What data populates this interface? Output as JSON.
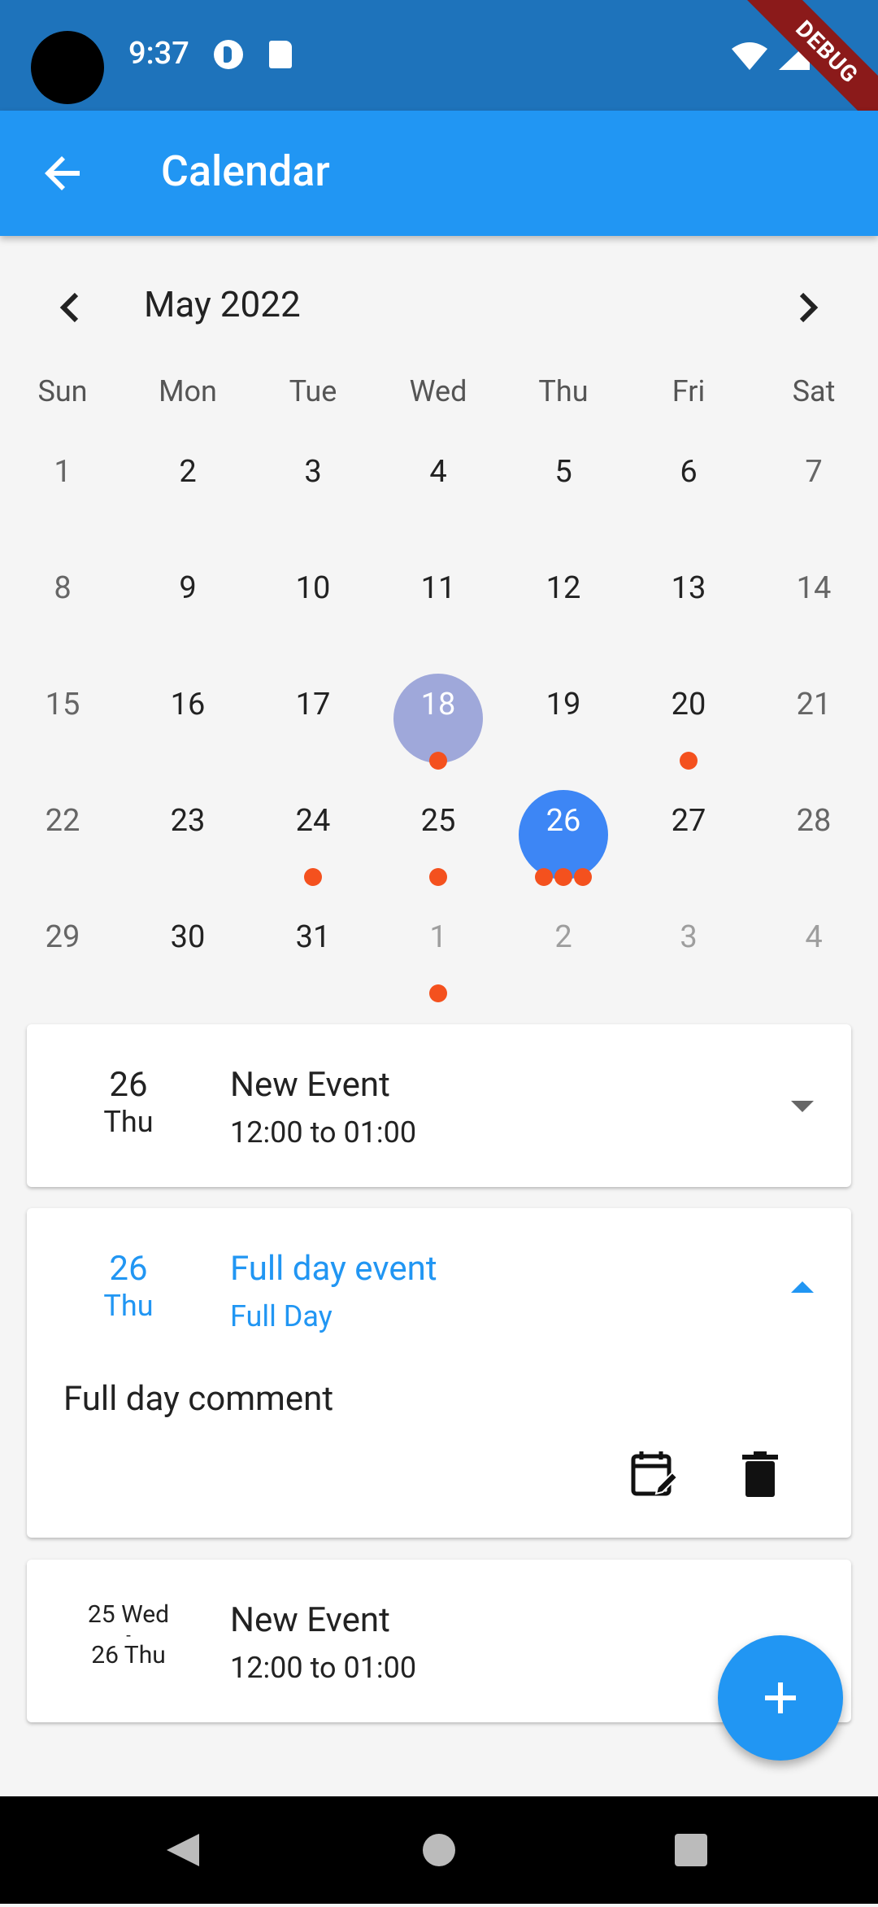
{
  "status_bar": {
    "time": "9:37",
    "debug_label": "DEBUG"
  },
  "app_bar": {
    "title": "Calendar"
  },
  "calendar": {
    "month_label": "May 2022",
    "weekdays": [
      "Sun",
      "Mon",
      "Tue",
      "Wed",
      "Thu",
      "Fri",
      "Sat"
    ],
    "weeks": [
      [
        "1",
        "2",
        "3",
        "4",
        "5",
        "6",
        "7"
      ],
      [
        "8",
        "9",
        "10",
        "11",
        "12",
        "13",
        "14"
      ],
      [
        "15",
        "16",
        "17",
        "18",
        "19",
        "20",
        "21"
      ],
      [
        "22",
        "23",
        "24",
        "25",
        "26",
        "27",
        "28"
      ],
      [
        "29",
        "30",
        "31",
        "1",
        "2",
        "3",
        "4"
      ]
    ]
  },
  "events": [
    {
      "day": "26",
      "weekday": "Thu",
      "title": "New Event",
      "time": "12:00 to 01:00"
    },
    {
      "day": "26",
      "weekday": "Thu",
      "title": "Full day event",
      "time": "Full Day",
      "comment": "Full day comment"
    },
    {
      "start": "25 Wed",
      "separator": "-",
      "end": "26 Thu",
      "title": "New Event",
      "time": "12:00 to 01:00"
    }
  ],
  "colors": {
    "app_bar": "#2196f3",
    "status_bar": "#1e73bb",
    "selected_day": "#3d86f5",
    "today": "#9fa8da",
    "event_dot": "#f4511e"
  }
}
